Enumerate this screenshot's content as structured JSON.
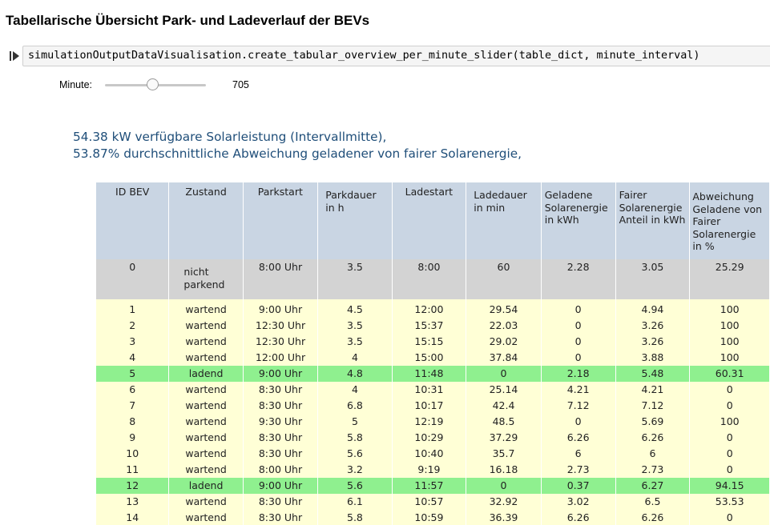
{
  "title": "Tabellarische Übersicht Park- und Ladeverlauf der BEVs",
  "code_cell": {
    "run_icon": "run-cell-icon",
    "code": "simulationOutputDataVisualisation.create_tabular_overview_per_minute_slider(table_dict, minute_interval)"
  },
  "slider": {
    "label": "Minute:",
    "value": "705",
    "fraction": 0.47
  },
  "summary": {
    "line1": "54.38 kW verfügbare Solarleistung (Intervallmitte),",
    "line2": "53.87% durchschnittliche Abweichung geladener von fairer Solarenergie,"
  },
  "colors": {
    "header_bg": "#c9d5e3",
    "not_parking_bg": "#d3d3d3",
    "waiting_bg": "#ffffd6",
    "charging_bg": "#8ff08f",
    "summary_text": "#1f4e79"
  },
  "table": {
    "headers": [
      "ID BEV",
      "Zustand",
      "Parkstart",
      "Parkdauer in h",
      "Ladestart",
      "Ladedauer in min",
      "Geladene Solarenergie in kWh",
      "Fairer Solarenergie Anteil in kWh",
      "Abweichung Geladene von Fairer Solarenergie in %"
    ],
    "rows": [
      {
        "id": "0",
        "state": "nicht parkend",
        "park_start": "8:00 Uhr",
        "park_duration": "3.5",
        "charge_start": "8:00",
        "charge_duration": "60",
        "charged": "2.28",
        "fair": "3.05",
        "deviation": "25.29",
        "kind": "gray"
      },
      {
        "id": "1",
        "state": "wartend",
        "park_start": "9:00 Uhr",
        "park_duration": "4.5",
        "charge_start": "12:00",
        "charge_duration": "29.54",
        "charged": "0",
        "fair": "4.94",
        "deviation": "100",
        "kind": "waiting"
      },
      {
        "id": "2",
        "state": "wartend",
        "park_start": "12:30 Uhr",
        "park_duration": "3.5",
        "charge_start": "15:37",
        "charge_duration": "22.03",
        "charged": "0",
        "fair": "3.26",
        "deviation": "100",
        "kind": "waiting"
      },
      {
        "id": "3",
        "state": "wartend",
        "park_start": "12:30 Uhr",
        "park_duration": "3.5",
        "charge_start": "15:15",
        "charge_duration": "29.02",
        "charged": "0",
        "fair": "3.26",
        "deviation": "100",
        "kind": "waiting"
      },
      {
        "id": "4",
        "state": "wartend",
        "park_start": "12:00 Uhr",
        "park_duration": "4",
        "charge_start": "15:00",
        "charge_duration": "37.84",
        "charged": "0",
        "fair": "3.88",
        "deviation": "100",
        "kind": "waiting"
      },
      {
        "id": "5",
        "state": "ladend",
        "park_start": "9:00 Uhr",
        "park_duration": "4.8",
        "charge_start": "11:48",
        "charge_duration": "0",
        "charged": "2.18",
        "fair": "5.48",
        "deviation": "60.31",
        "kind": "charging"
      },
      {
        "id": "6",
        "state": "wartend",
        "park_start": "8:30 Uhr",
        "park_duration": "4",
        "charge_start": "10:31",
        "charge_duration": "25.14",
        "charged": "4.21",
        "fair": "4.21",
        "deviation": "0",
        "kind": "waiting"
      },
      {
        "id": "7",
        "state": "wartend",
        "park_start": "8:30 Uhr",
        "park_duration": "6.8",
        "charge_start": "10:17",
        "charge_duration": "42.4",
        "charged": "7.12",
        "fair": "7.12",
        "deviation": "0",
        "kind": "waiting"
      },
      {
        "id": "8",
        "state": "wartend",
        "park_start": "9:30 Uhr",
        "park_duration": "5",
        "charge_start": "12:19",
        "charge_duration": "48.5",
        "charged": "0",
        "fair": "5.69",
        "deviation": "100",
        "kind": "waiting"
      },
      {
        "id": "9",
        "state": "wartend",
        "park_start": "8:30 Uhr",
        "park_duration": "5.8",
        "charge_start": "10:29",
        "charge_duration": "37.29",
        "charged": "6.26",
        "fair": "6.26",
        "deviation": "0",
        "kind": "waiting"
      },
      {
        "id": "10",
        "state": "wartend",
        "park_start": "8:30 Uhr",
        "park_duration": "5.6",
        "charge_start": "10:40",
        "charge_duration": "35.7",
        "charged": "6",
        "fair": "6",
        "deviation": "0",
        "kind": "waiting"
      },
      {
        "id": "11",
        "state": "wartend",
        "park_start": "8:00 Uhr",
        "park_duration": "3.2",
        "charge_start": "9:19",
        "charge_duration": "16.18",
        "charged": "2.73",
        "fair": "2.73",
        "deviation": "0",
        "kind": "waiting"
      },
      {
        "id": "12",
        "state": "ladend",
        "park_start": "9:00 Uhr",
        "park_duration": "5.6",
        "charge_start": "11:57",
        "charge_duration": "0",
        "charged": "0.37",
        "fair": "6.27",
        "deviation": "94.15",
        "kind": "charging"
      },
      {
        "id": "13",
        "state": "wartend",
        "park_start": "8:30 Uhr",
        "park_duration": "6.1",
        "charge_start": "10:57",
        "charge_duration": "32.92",
        "charged": "3.02",
        "fair": "6.5",
        "deviation": "53.53",
        "kind": "waiting"
      },
      {
        "id": "14",
        "state": "wartend",
        "park_start": "8:30 Uhr",
        "park_duration": "5.8",
        "charge_start": "10:59",
        "charge_duration": "36.39",
        "charged": "6.26",
        "fair": "6.26",
        "deviation": "0",
        "kind": "waiting"
      }
    ]
  }
}
